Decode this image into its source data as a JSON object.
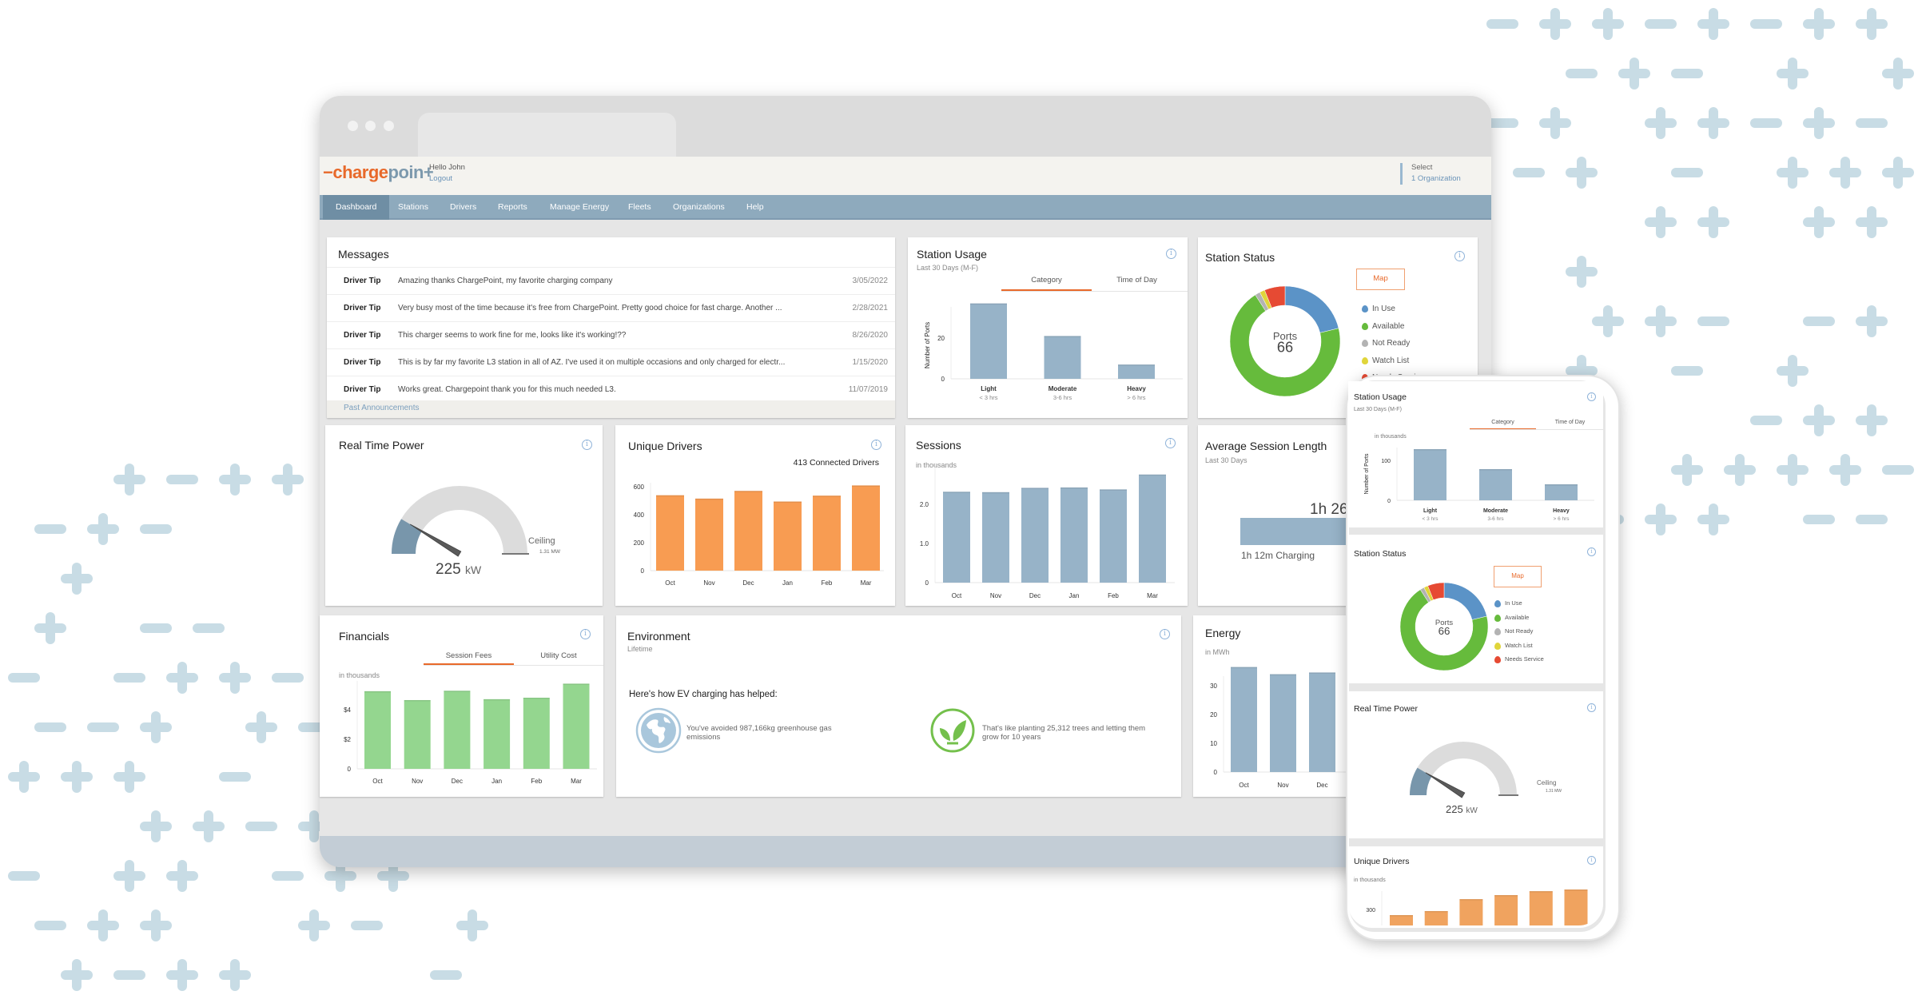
{
  "colors": {
    "brand_orange": "#e8692a",
    "nav": "#8eaabd",
    "bar_blue": "#97b3c8",
    "bar_orange": "#f89c52",
    "bar_green": "#94d68f",
    "decor": "#c8dce5"
  },
  "header": {
    "logo": "chargepoin+",
    "greeting": "Hello John",
    "logout": "Logout",
    "select_label": "Select",
    "org": "1 Organization"
  },
  "nav": [
    "Dashboard",
    "Stations",
    "Drivers",
    "Reports",
    "Manage Energy",
    "Fleets",
    "Organizations",
    "Help"
  ],
  "nav_active": "Dashboard",
  "messages": {
    "title": "Messages",
    "rows": [
      {
        "type": "Driver Tip",
        "text": "Amazing thanks ChargePoint, my favorite charging company",
        "date": "3/05/2022"
      },
      {
        "type": "Driver Tip",
        "text": "Very busy most of the time because it's free from ChargePoint. Pretty good choice for fast charge. Another ...",
        "date": "2/28/2021"
      },
      {
        "type": "Driver Tip",
        "text": "This charger seems to work fine for me, looks like it's working!??",
        "date": "8/26/2020"
      },
      {
        "type": "Driver Tip",
        "text": "This is by far my favorite L3 station in all of AZ. I've used it on multiple occasions and only charged for electr...",
        "date": "1/15/2020"
      },
      {
        "type": "Driver Tip",
        "text": "Works great. Chargepoint thank you for this much needed L3.",
        "date": "11/07/2019"
      }
    ],
    "footer": "Past Announcements"
  },
  "station_usage": {
    "title": "Station Usage",
    "subtitle": "Last 30 Days (M-F)",
    "tabs": [
      "Category",
      "Time of Day"
    ],
    "active_tab": "Category"
  },
  "station_status": {
    "title": "Station Status",
    "map_button": "Map",
    "center_label": "Ports",
    "center_value": "66"
  },
  "real_time_power": {
    "title": "Real Time Power",
    "value": "225",
    "unit": "kW",
    "ceiling_label": "Ceiling",
    "ceiling_value": "1.31 MW"
  },
  "unique_drivers": {
    "title": "Unique Drivers",
    "connected": "413 Connected Drivers",
    "unit_note": "in thousands"
  },
  "sessions": {
    "title": "Sessions",
    "unit_note": "in thousands"
  },
  "avg_session": {
    "title": "Average Session Length",
    "subtitle": "Last 30 Days",
    "total": "1h 26m",
    "charging": "1h 12m Charging"
  },
  "financials": {
    "title": "Financials",
    "tabs": [
      "Session Fees",
      "Utility Cost"
    ],
    "active_tab": "Session Fees",
    "unit_note": "in thousands"
  },
  "environment": {
    "title": "Environment",
    "subtitle": "Lifetime",
    "headline": "Here's how EV charging has helped:",
    "items": [
      {
        "icon": "globe-icon",
        "text": "You've avoided 987,166kg greenhouse gas emissions"
      },
      {
        "icon": "leaf-icon",
        "text": "That's like planting 25,312 trees and letting them grow for 10 years"
      }
    ]
  },
  "energy": {
    "title": "Energy",
    "unit_note": "in MWh"
  },
  "phone": {
    "station_usage_unit": "in thousands"
  },
  "chart_data": [
    {
      "id": "station_usage",
      "type": "bar",
      "categories": [
        "Light",
        "Moderate",
        "Heavy"
      ],
      "sublabels": [
        "< 3 hrs",
        "3-6 hrs",
        "> 6 hrs"
      ],
      "values": [
        37,
        21,
        7
      ],
      "ylabel": "Number of Ports",
      "yticks": [
        "0",
        "20"
      ],
      "ytick_values": [
        0,
        20
      ],
      "color": "#97b3c8"
    },
    {
      "id": "unique_drivers",
      "type": "bar",
      "categories": [
        "Oct",
        "Nov",
        "Dec",
        "Jan",
        "Feb",
        "Mar"
      ],
      "values": [
        539,
        515,
        570,
        494,
        536,
        609
      ],
      "yticks": [
        "0",
        "200",
        "400",
        "600"
      ],
      "ytick_values": [
        0,
        200,
        400,
        600
      ],
      "color": "#f89c52"
    },
    {
      "id": "sessions",
      "type": "bar",
      "categories": [
        "Oct",
        "Nov",
        "Dec",
        "Jan",
        "Feb",
        "Mar"
      ],
      "values": [
        2.32,
        2.31,
        2.42,
        2.43,
        2.38,
        2.76
      ],
      "yticks": [
        "0",
        "1.0",
        "2.0"
      ],
      "ytick_values": [
        0,
        1,
        2
      ],
      "color": "#97b3c8"
    },
    {
      "id": "financials",
      "type": "bar",
      "categories": [
        "Oct",
        "Nov",
        "Dec",
        "Jan",
        "Feb",
        "Mar"
      ],
      "values": [
        5.25,
        4.65,
        5.28,
        4.71,
        4.81,
        5.76
      ],
      "yticks": [
        "0",
        "$2",
        "$4"
      ],
      "ytick_values": [
        0,
        2,
        4
      ],
      "color": "#94d68f"
    },
    {
      "id": "energy",
      "type": "bar",
      "categories": [
        "Oct",
        "Nov",
        "Dec"
      ],
      "values": [
        36.5,
        34.0,
        34.6
      ],
      "yticks": [
        "0",
        "10",
        "20",
        "30"
      ],
      "ytick_values": [
        0,
        10,
        20,
        30
      ],
      "color": "#97b3c8"
    },
    {
      "id": "station_status",
      "type": "pie",
      "categories": [
        "In Use",
        "Available",
        "Not Ready",
        "Watch List",
        "Needs Service"
      ],
      "values": [
        14,
        46,
        1,
        1,
        4
      ],
      "colors": [
        "#5b93c7",
        "#66bb3c",
        "#b3b3b3",
        "#e0d53a",
        "#e64a33"
      ]
    },
    {
      "id": "real_time_power",
      "type": "gauge",
      "value_kw": 225,
      "max_kw": 1310,
      "fill": "#7896ab",
      "track": "#dcdcdc"
    },
    {
      "id": "phone_station_usage",
      "type": "bar",
      "categories": [
        "Light",
        "Moderate",
        "Heavy"
      ],
      "sublabels": [
        "< 3 hrs",
        "3-6 hrs",
        "> 6 hrs"
      ],
      "values": [
        128,
        78,
        40
      ],
      "ylabel": "Number of Ports",
      "yticks": [
        "0",
        "100"
      ],
      "ytick_values": [
        0,
        100
      ],
      "color": "#97b3c8"
    },
    {
      "id": "phone_unique_drivers",
      "type": "bar",
      "categories": [
        "Oct",
        "Nov",
        "Dec",
        "Jan",
        "Feb",
        "Mar"
      ],
      "values": [
        243,
        284,
        405,
        446,
        486,
        503
      ],
      "yticks": [
        "300"
      ],
      "ytick_values": [
        300
      ],
      "color": "#f0a35f"
    }
  ]
}
